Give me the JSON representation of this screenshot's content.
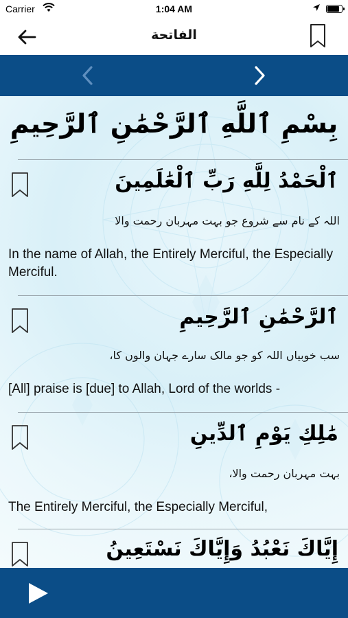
{
  "status_bar": {
    "carrier": "Carrier",
    "time": "1:04 AM",
    "battery_level": 0.9
  },
  "nav": {
    "title": "الفاتحة"
  },
  "bismillah": "بِسْمِ ٱللَّهِ ٱلرَّحْمَٰنِ ٱلرَّحِيمِ",
  "verses": [
    {
      "arabic": "ٱلْحَمْدُ لِلَّهِ رَبِّ ٱلْعَٰلَمِينَ",
      "urdu": "اللہ کے نام سے شروع جو بہت مہربان رحمت والا",
      "english": "In the name of Allah, the Entirely Merciful, the Especially Merciful."
    },
    {
      "arabic": "ٱلرَّحْمَٰنِ ٱلرَّحِيمِ",
      "urdu": "سب خوبیاں اللہ کو جو مالک سارے جہان والوں کا،",
      "english": "[All] praise is [due] to Allah, Lord of the worlds -"
    },
    {
      "arabic": "مَٰلِكِ يَوْمِ ٱلدِّينِ",
      "urdu": "بہت مہربان رحمت والا،",
      "english": "The Entirely Merciful, the Especially Merciful,"
    },
    {
      "arabic": "إِيَّاكَ نَعْبُدُ وَإِيَّاكَ نَسْتَعِينُ",
      "urdu": "",
      "english": ""
    }
  ],
  "colors": {
    "accent": "#0b4d87",
    "background": "#e3f3f9",
    "divider": "#9aa6ad"
  },
  "icons": {
    "back": "arrow-left-icon",
    "bookmark": "bookmark-icon",
    "prev": "chevron-left-icon",
    "next": "chevron-right-icon",
    "play": "play-icon",
    "wifi": "wifi-icon",
    "location": "location-arrow-icon",
    "battery": "battery-icon"
  }
}
